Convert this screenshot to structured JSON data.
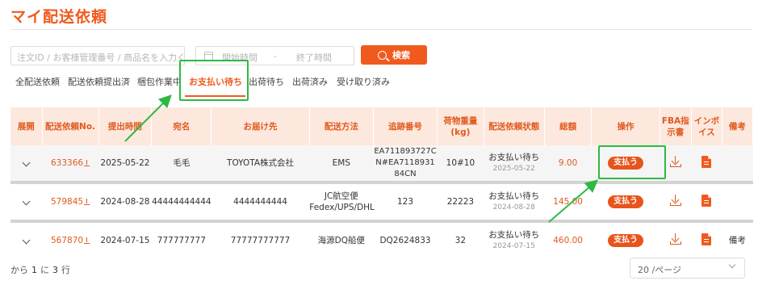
{
  "page": {
    "title": "マイ配送依頼"
  },
  "filters": {
    "search_placeholder": "注文ID / お客様管理番号 / 商品名を入力くださ",
    "start_placeholder": "開始時間",
    "range_sep": "-",
    "end_placeholder": "終了時間",
    "search_button": "検索"
  },
  "tabs": [
    "全配送依頼",
    "配送依頼提出済",
    "梱包作業中",
    "お支払い待ち",
    "出荷待ち",
    "出荷済み",
    "受け取り済み"
  ],
  "active_tab": "お支払い待ち",
  "table": {
    "headers": [
      "展開",
      "配送依頼No.",
      "提出時間",
      "宛名",
      "お届け先",
      "配送方法",
      "追跡番号",
      "荷物重量(kg)",
      "配送依頼状態",
      "総額",
      "操作",
      "FBA指示書",
      "インボイス",
      "備考"
    ],
    "rows": [
      {
        "no": "633366",
        "time": "2025-05-22",
        "name": "毛毛",
        "dest": "TOYOTA株式会社",
        "method": "EMS",
        "tracking": "EA711893727CN#EA711893184CN",
        "weight": "10#10",
        "status": "お支払い待ち",
        "status_date": "2025-05-22",
        "total": "9.00",
        "action": "支払う",
        "note": ""
      },
      {
        "no": "579845",
        "time": "2024-08-28",
        "name": "44444444444",
        "dest": "4444444444",
        "method": "JC航空便Fedex/UPS/DHL",
        "tracking": "123",
        "weight": "22223",
        "status": "お支払い待ち",
        "status_date": "2024-08-28",
        "total": "145.00",
        "action": "支払う",
        "note": ""
      },
      {
        "no": "567870",
        "time": "2024-07-15",
        "name": "777777777",
        "dest": "77777777777",
        "method": "海源DQ船便",
        "tracking": "DQ2624833",
        "weight": "32",
        "status": "お支払い待ち",
        "status_date": "2024-07-15",
        "total": "460.00",
        "action": "支払う",
        "note": "備考"
      }
    ]
  },
  "pagination": {
    "prefix": "から",
    "from": "1",
    "mid": "に",
    "count": "3",
    "suffix": "行",
    "page_size": "20 /ページ"
  },
  "colors": {
    "accent": "#f05a1e",
    "highlight": "#2db944"
  }
}
